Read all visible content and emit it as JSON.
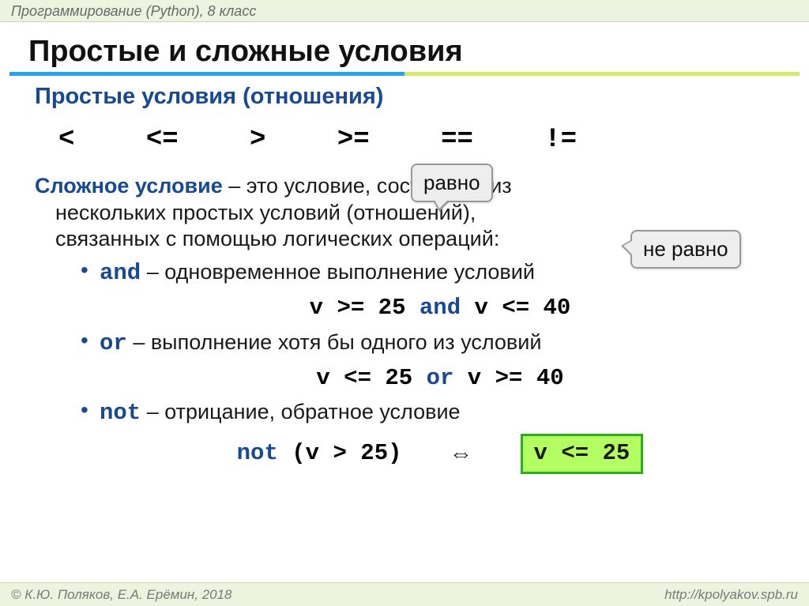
{
  "header": {
    "breadcrumb": "Программирование (Python), 8 класс"
  },
  "title": "Простые и сложные условия",
  "section1": {
    "heading": "Простые условия (отношения)"
  },
  "callouts": {
    "equal": "равно",
    "not_equal": "не равно"
  },
  "operators": [
    "<",
    "<=",
    ">",
    ">=",
    "==",
    "!="
  ],
  "definition": {
    "term": "Сложное условие",
    "rest1": " – это условие, состоящее из",
    "line2": "нескольких простых условий (отношений),",
    "line3": "связанных с помощью логических операций:"
  },
  "ops": [
    {
      "kw": "and",
      "desc": " – одновременное выполнение условий",
      "code_pre": "v >= 25 ",
      "code_kw": "and",
      "code_post": " v <= 40"
    },
    {
      "kw": "or",
      "desc": " – выполнение хотя бы одного из условий",
      "code_pre": "v <= 25 ",
      "code_kw": "or",
      "code_post": " v >= 40"
    },
    {
      "kw": "not",
      "desc": " – отрицание, обратное условие",
      "not_kw": "not",
      "not_rest": " (v > 25)",
      "arrow": "⇔",
      "equiv": "v <= 25"
    }
  ],
  "footer": {
    "left": "© К.Ю. Поляков, Е.А. Ерёмин, 2018",
    "right": "http://kpolyakov.spb.ru"
  }
}
